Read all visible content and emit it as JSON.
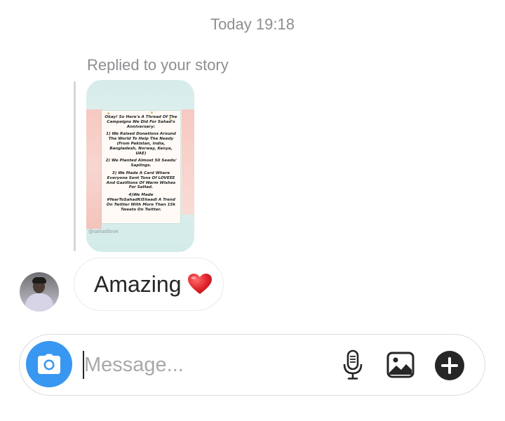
{
  "thread": {
    "timestamp": "Today 19:18"
  },
  "story_reply": {
    "label": "Replied to your story",
    "story_text": [
      "Okay! So Here's A Thread Of The Campaigns We Did For Sahad's Anniversary:",
      "1) We Raised Donations Around The World To Help The Needy (From Pakistan, India, Bangladesh, Norway, Kenya, UAE)",
      "2) We Planted Almost 50 Seeds/ Saplings.",
      "3) We Made A Card Where Everyone Sent Tons Of LOVEEE And Gazillions Of Warm Wishes For SaHad.",
      "4)We Made #YearToSahadKiShaadi A Trend On Twitter With More Than 15k Tweets On Twitter."
    ],
    "story_watermark": "@sahadlove"
  },
  "message": {
    "text": "Amazing",
    "emoji_icon": "red-heart-icon"
  },
  "composer": {
    "placeholder": "Message...",
    "value": "",
    "accent_color": "#3897f0"
  },
  "icons": {
    "camera": "camera-icon",
    "mic": "microphone-icon",
    "gallery": "image-icon",
    "plus": "plus-circle-icon"
  }
}
